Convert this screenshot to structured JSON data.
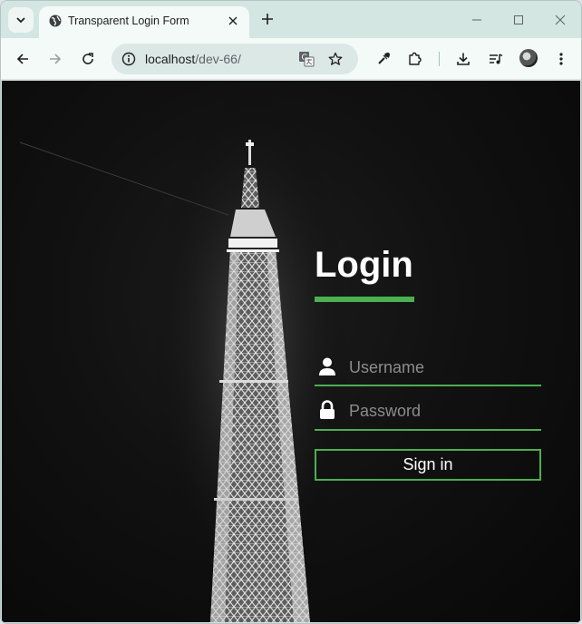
{
  "browser": {
    "tab_title": "Transparent Login Form",
    "url_host": "localhost",
    "url_path": "/dev-66/"
  },
  "login": {
    "heading": "Login",
    "username_placeholder": "Username",
    "password_placeholder": "Password",
    "signin_label": "Sign in",
    "accent_color": "#4caf50"
  },
  "icons": {
    "tab_search": "chevron-down-icon",
    "favicon": "globe-icon",
    "tab_close": "close-icon",
    "new_tab": "plus-icon",
    "minimize": "minimize-icon",
    "maximize": "maximize-icon",
    "window_close": "close-icon",
    "back": "arrow-left-icon",
    "forward": "arrow-right-icon",
    "reload": "reload-icon",
    "site_info": "info-icon",
    "translate": "translate-icon",
    "bookmark": "star-icon",
    "eyedropper": "eyedropper-icon",
    "extensions": "puzzle-icon",
    "downloads": "download-icon",
    "media": "media-queue-icon",
    "menu": "kebab-menu-icon",
    "user_field": "user-icon",
    "password_field": "lock-icon"
  }
}
